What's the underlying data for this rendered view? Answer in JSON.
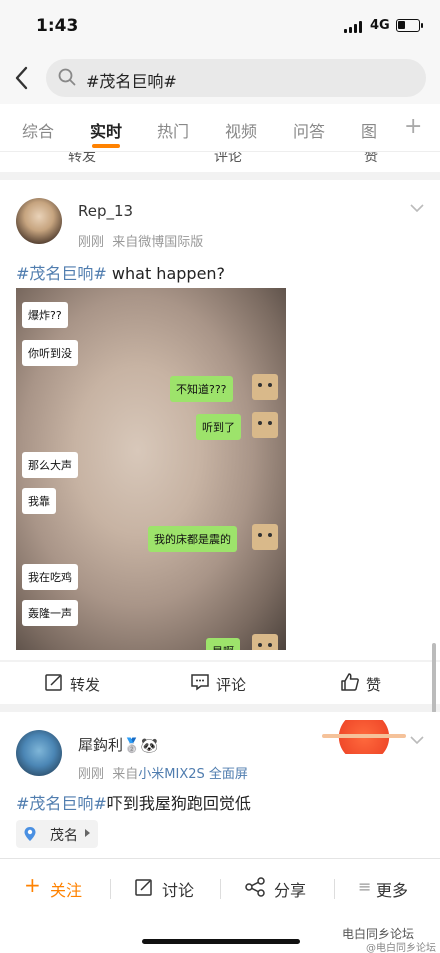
{
  "status": {
    "time": "1:43",
    "network": "4G"
  },
  "search": {
    "query": "#茂名巨响#"
  },
  "tabs": [
    "综合",
    "实时",
    "热门",
    "视频",
    "问答",
    "图"
  ],
  "prev_actions": {
    "repost": "转发",
    "comment": "评论",
    "like": "赞"
  },
  "post1": {
    "username": "Rep_13",
    "time": "刚刚",
    "source": "来自微博国际版",
    "hashtag": "#茂名巨响#",
    "text": " what happen?",
    "chat": [
      {
        "side": "left",
        "text": "爆炸??"
      },
      {
        "side": "left",
        "text": "你听到没"
      },
      {
        "side": "right",
        "text": "不知道???"
      },
      {
        "side": "right",
        "text": "听到了"
      },
      {
        "side": "left",
        "text": "那么大声"
      },
      {
        "side": "left",
        "text": "我靠"
      },
      {
        "side": "right",
        "text": "我的床都是震的"
      },
      {
        "side": "left",
        "text": "我在吃鸡"
      },
      {
        "side": "left",
        "text": "轰隆一声"
      },
      {
        "side": "right",
        "text": "是啊"
      }
    ],
    "actions": {
      "repost": "转发",
      "comment": "评论",
      "like": "赞"
    }
  },
  "post2": {
    "username": "犀鈎利",
    "badges": "🥈🐼",
    "time": "刚刚",
    "source_prefix": "来自",
    "source_device": "小米MIX2S 全面屏",
    "hashtag": "#茂名巨响#",
    "text": "吓到我屋狗跑回觉低",
    "location": "茂名"
  },
  "bottom": {
    "follow": "关注",
    "discuss": "讨论",
    "share": "分享",
    "more": "更多"
  },
  "watermark": "电白同乡论坛",
  "watermark_sub": "@电白同乡论坛",
  "colors": {
    "accent": "#ff8200",
    "link": "#507daf",
    "chat_green": "#9de36b"
  }
}
